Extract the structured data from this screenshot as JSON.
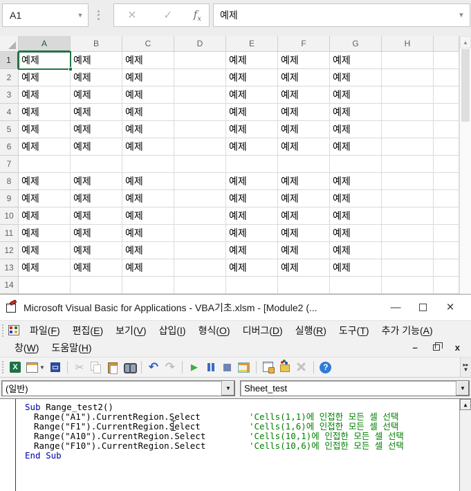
{
  "excel": {
    "name_box_value": "A1",
    "formula_bar_value": "예제",
    "fx_label": "fx",
    "columns": [
      "A",
      "B",
      "C",
      "D",
      "E",
      "F",
      "G",
      "H"
    ],
    "row_count": 14,
    "cell_text": "예제",
    "filled_columns": [
      "A",
      "B",
      "C",
      "E",
      "F",
      "G"
    ],
    "filled_rows": [
      1,
      2,
      3,
      4,
      5,
      6,
      8,
      9,
      10,
      11,
      12,
      13
    ],
    "selected_cell": "A1",
    "selected_column": "A",
    "selected_row": 1,
    "selection_color": "#217346"
  },
  "vba": {
    "window_title": "Microsoft Visual Basic for Applications - VBA기초.xlsm - [Module2 (...",
    "menu_row1": [
      {
        "pre": "파일(",
        "key": "F",
        "post": ")"
      },
      {
        "pre": "편집(",
        "key": "E",
        "post": ")"
      },
      {
        "pre": "보기(",
        "key": "V",
        "post": ")"
      },
      {
        "pre": "삽입(",
        "key": "I",
        "post": ")"
      },
      {
        "pre": "형식(",
        "key": "O",
        "post": ")"
      },
      {
        "pre": "디버그(",
        "key": "D",
        "post": ")"
      },
      {
        "pre": "실행(",
        "key": "R",
        "post": ")"
      },
      {
        "pre": "도구(",
        "key": "T",
        "post": ")"
      },
      {
        "pre": "추가 기능(",
        "key": "A",
        "post": ")"
      }
    ],
    "menu_row2": [
      {
        "pre": "창(",
        "key": "W",
        "post": ")"
      },
      {
        "pre": "도움말(",
        "key": "H",
        "post": ")"
      }
    ],
    "toolbar_icons": [
      {
        "name": "view-excel-icon"
      },
      {
        "name": "insert-userform-icon",
        "dropdown": true
      },
      {
        "name": "save-icon"
      },
      {
        "name": "separator"
      },
      {
        "name": "cut-icon",
        "disabled": true
      },
      {
        "name": "copy-icon",
        "disabled": true
      },
      {
        "name": "paste-icon"
      },
      {
        "name": "find-icon"
      },
      {
        "name": "separator"
      },
      {
        "name": "undo-icon"
      },
      {
        "name": "redo-icon",
        "disabled": true
      },
      {
        "name": "separator"
      },
      {
        "name": "run-icon"
      },
      {
        "name": "break-icon"
      },
      {
        "name": "reset-icon"
      },
      {
        "name": "design-mode-icon"
      },
      {
        "name": "separator"
      },
      {
        "name": "properties-icon"
      },
      {
        "name": "object-browser-icon"
      },
      {
        "name": "toolbox-icon",
        "disabled": true
      },
      {
        "name": "separator"
      },
      {
        "name": "help-icon"
      }
    ],
    "object_combo_value": "(일반)",
    "procedure_combo_value": "Sheet_test",
    "code_lines": [
      {
        "kw": "Sub",
        "code": " Range_test2()",
        "comment": "",
        "indent": false
      },
      {
        "kw": "",
        "code": "Range(\"A1\").CurrentRegion.Select",
        "comment": "'Cells(1,1)에 인접한 모든 셀 선택",
        "indent": true
      },
      {
        "kw": "",
        "code": "Range(\"F1\").CurrentRegion.Select",
        "comment": "'Cells(1,6)에 인접한 모든 셀 선택",
        "indent": true
      },
      {
        "kw": "",
        "code": "Range(\"A10\").CurrentRegion.Select",
        "comment": "'Cells(10,1)에 인접한 모든 셀 선택",
        "indent": true
      },
      {
        "kw": "",
        "code": "Range(\"F10\").CurrentRegion.Select",
        "comment": "'Cells(10,6)에 인접한 모든 셀 선택",
        "indent": true
      },
      {
        "kw": "End Sub",
        "code": "",
        "comment": "",
        "indent": false
      }
    ],
    "keyword_color": "#0000A6",
    "comment_color": "#007F00"
  }
}
